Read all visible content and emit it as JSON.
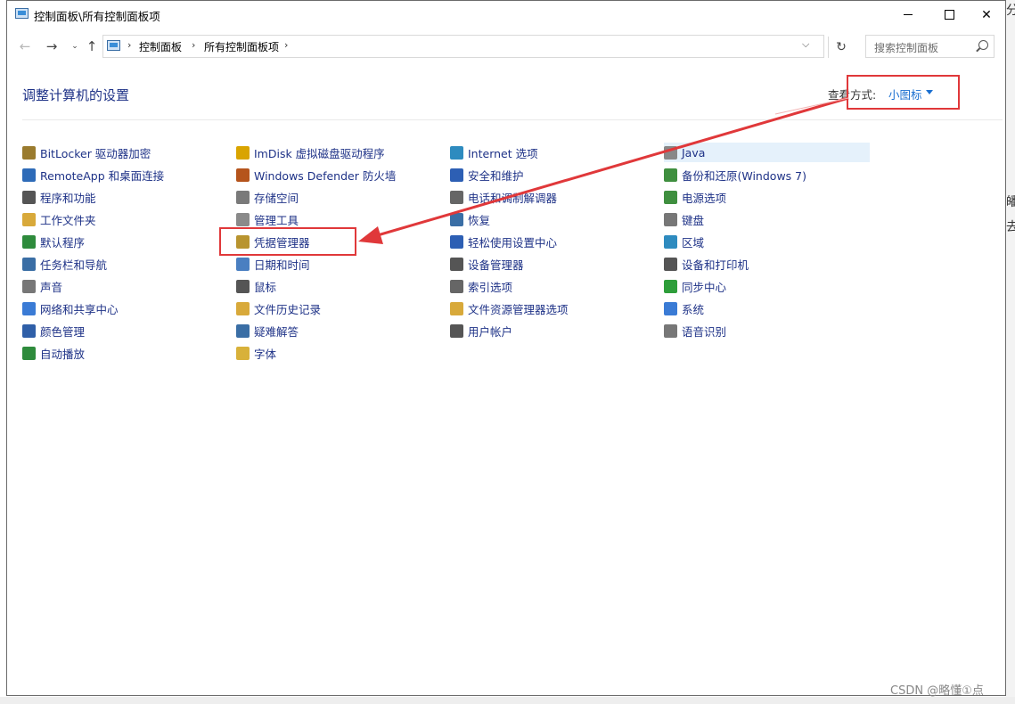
{
  "window": {
    "title": "控制面板\\所有控制面板项",
    "controls": {
      "close_label": "✕"
    }
  },
  "address_bar": {
    "breadcrumbs": [
      "控制面板",
      "所有控制面板项"
    ],
    "separator": "›",
    "refresh_icon": "↻",
    "search_placeholder": "搜索控制面板"
  },
  "nav": {
    "back": "←",
    "forward": "→",
    "recent": "⌄",
    "up": "↑"
  },
  "header": {
    "title": "调整计算机的设置",
    "view_by_label": "查看方式:",
    "view_by_value": "小图标"
  },
  "columns": [
    [
      {
        "label": "BitLocker 驱动器加密",
        "icon": "bitlocker-icon",
        "color": "#9a7b2e"
      },
      {
        "label": "RemoteApp 和桌面连接",
        "icon": "remoteapp-icon",
        "color": "#2e6bb8"
      },
      {
        "label": "程序和功能",
        "icon": "programs-icon",
        "color": "#555555"
      },
      {
        "label": "工作文件夹",
        "icon": "work-folders-icon",
        "color": "#d8a93a"
      },
      {
        "label": "默认程序",
        "icon": "default-programs-icon",
        "color": "#2e8b3c"
      },
      {
        "label": "任务栏和导航",
        "icon": "taskbar-icon",
        "color": "#3a6ea5"
      },
      {
        "label": "声音",
        "icon": "sound-icon",
        "color": "#777777"
      },
      {
        "label": "网络和共享中心",
        "icon": "network-icon",
        "color": "#3a7bd5"
      },
      {
        "label": "颜色管理",
        "icon": "color-management-icon",
        "color": "#2f5fa8"
      },
      {
        "label": "自动播放",
        "icon": "autoplay-icon",
        "color": "#2e8b3c"
      }
    ],
    [
      {
        "label": "ImDisk 虚拟磁盘驱动程序",
        "icon": "imdisk-icon",
        "color": "#d9a400"
      },
      {
        "label": "Windows Defender 防火墙",
        "icon": "firewall-icon",
        "color": "#b5541c"
      },
      {
        "label": "存储空间",
        "icon": "storage-spaces-icon",
        "color": "#7a7a7a"
      },
      {
        "label": "管理工具",
        "icon": "admin-tools-icon",
        "color": "#8a8a8a"
      },
      {
        "label": "凭据管理器",
        "icon": "credential-manager-icon",
        "color": "#b8942f"
      },
      {
        "label": "日期和时间",
        "icon": "date-time-icon",
        "color": "#4a7fc1"
      },
      {
        "label": "鼠标",
        "icon": "mouse-icon",
        "color": "#555555"
      },
      {
        "label": "文件历史记录",
        "icon": "file-history-icon",
        "color": "#d8a93a"
      },
      {
        "label": "疑难解答",
        "icon": "troubleshooting-icon",
        "color": "#3a6ea5"
      },
      {
        "label": "字体",
        "icon": "fonts-icon",
        "color": "#d8b13a"
      }
    ],
    [
      {
        "label": "Internet 选项",
        "icon": "internet-options-icon",
        "color": "#2e8bbf"
      },
      {
        "label": "安全和维护",
        "icon": "security-maintenance-icon",
        "color": "#2d5fb4"
      },
      {
        "label": "电话和调制解调器",
        "icon": "phone-modem-icon",
        "color": "#666666"
      },
      {
        "label": "恢复",
        "icon": "recovery-icon",
        "color": "#3a6ea5"
      },
      {
        "label": "轻松使用设置中心",
        "icon": "ease-of-access-icon",
        "color": "#2d5fb4"
      },
      {
        "label": "设备管理器",
        "icon": "device-manager-icon",
        "color": "#555555"
      },
      {
        "label": "索引选项",
        "icon": "indexing-icon",
        "color": "#666666"
      },
      {
        "label": "文件资源管理器选项",
        "icon": "explorer-options-icon",
        "color": "#d8a93a"
      },
      {
        "label": "用户帐户",
        "icon": "user-accounts-icon",
        "color": "#555555"
      }
    ],
    [
      {
        "label": "Java",
        "icon": "java-icon",
        "color": "#888888"
      },
      {
        "label": "备份和还原(Windows 7)",
        "icon": "backup-restore-icon",
        "color": "#3f8f3f"
      },
      {
        "label": "电源选项",
        "icon": "power-options-icon",
        "color": "#3f8f3f"
      },
      {
        "label": "键盘",
        "icon": "keyboard-icon",
        "color": "#777777"
      },
      {
        "label": "区域",
        "icon": "region-icon",
        "color": "#2e8bbf"
      },
      {
        "label": "设备和打印机",
        "icon": "devices-printers-icon",
        "color": "#555555"
      },
      {
        "label": "同步中心",
        "icon": "sync-center-icon",
        "color": "#2e9e3a"
      },
      {
        "label": "系统",
        "icon": "system-icon",
        "color": "#3a7bd5"
      },
      {
        "label": "语音识别",
        "icon": "speech-recognition-icon",
        "color": "#777777"
      }
    ]
  ],
  "watermark": "CSDN @略懂①点",
  "colors": {
    "link": "#1e3287",
    "accent": "#1a6fd0",
    "annotation": "#e0383a",
    "hover_highlight": "#e5f1fb"
  }
}
